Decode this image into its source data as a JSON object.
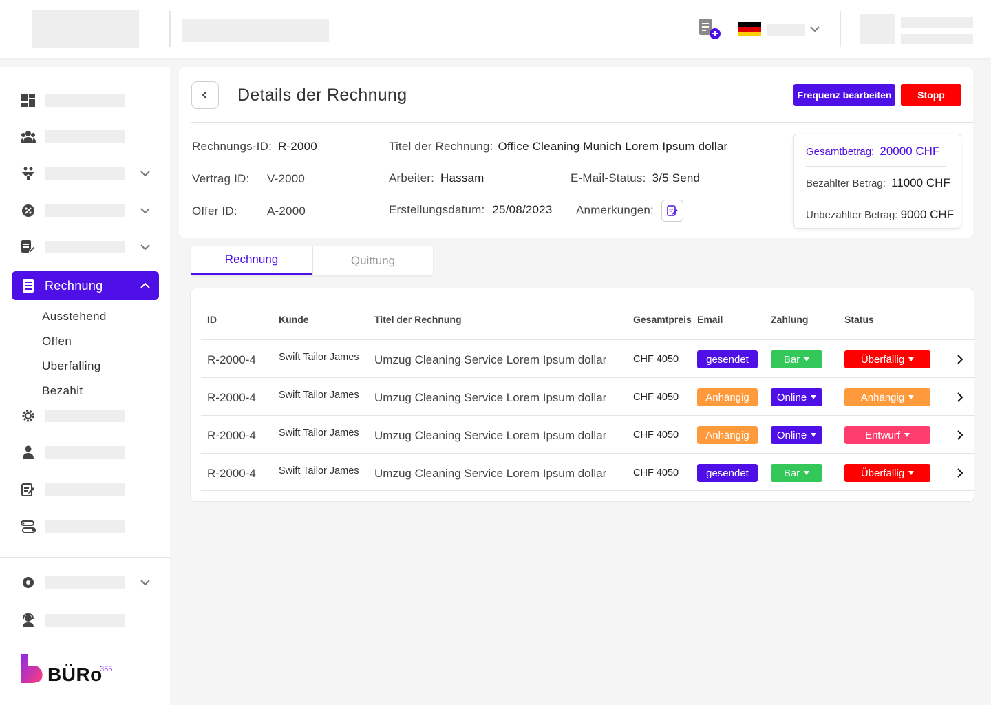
{
  "colors": {
    "primary": "#4f10e8",
    "danger": "#ff0000",
    "orange": "#ff9a3c",
    "green": "#34c759",
    "pink": "#ff3d6e"
  },
  "topbar": {
    "icons": [
      "add-document-icon",
      "german-flag-icon",
      "chevron-down-icon"
    ]
  },
  "sidebar": {
    "icons": [
      "dashboard-icon",
      "users-icon",
      "handshake-icon",
      "badge-icon",
      "edit-document-icon",
      "invoice-icon",
      "settings-gear-icon",
      "person-icon",
      "notes-icon",
      "route-icon",
      "cog-icon",
      "support-icon"
    ],
    "active_label": "Rechnung",
    "sub_items": [
      "Ausstehend",
      "Offen",
      "Uberfalling",
      "Bezahit"
    ],
    "logo_text": "BÜRo",
    "logo_sup": "365"
  },
  "header": {
    "title": "Details der Rechnung",
    "edit_button": "Frequenz bearbeiten",
    "stop_button": "Stopp"
  },
  "details": {
    "invoice_id_label": "Rechnungs-ID:",
    "invoice_id": "R-2000",
    "contract_label": "Vertrag ID:",
    "contract_id": "V-2000",
    "offer_label": "Offer ID:",
    "offer_id": "A-2000",
    "title_label": "Titel der Rechnung:",
    "title_value": "Office Cleaning Munich Lorem Ipsum dollar",
    "worker_label": "Arbeiter:",
    "worker_value": "Hassam",
    "date_label": "Erstellungsdatum:",
    "date_value": "25/08/2023",
    "email_status_label": "E-Mail-Status:",
    "email_status_value": "3/5 Send",
    "notes_label": "Anmerkungen:"
  },
  "totals": {
    "total_label": "Gesamtbetrag:",
    "total_value": "20000 CHF",
    "paid_label": "Bezahlter Betrag:",
    "paid_value": "11000 CHF",
    "unpaid_label": "Unbezahlter Betrag:",
    "unpaid_value": "9000 CHF"
  },
  "tabs": {
    "active": "Rechnung",
    "inactive": "Quittung"
  },
  "table": {
    "headers": [
      "ID",
      "Kunde",
      "Titel der Rechnung",
      "Gesamtpreis",
      "Email",
      "Zahlung",
      "Status"
    ],
    "rows": [
      {
        "id": "R-2000-4",
        "customer": "Swift Tailor James",
        "title": "Umzug Cleaning Service Lorem Ipsum dollar",
        "price": "CHF 4050",
        "email": "gesendet",
        "payment": "Bar",
        "status": "Überfällig"
      },
      {
        "id": "R-2000-4",
        "customer": "Swift Tailor James",
        "title": "Umzug Cleaning Service Lorem Ipsum dollar",
        "price": "CHF 4050",
        "email": "Anhängig",
        "payment": "Online",
        "status": "Anhängig"
      },
      {
        "id": "R-2000-4",
        "customer": "Swift Tailor James",
        "title": "Umzug Cleaning Service Lorem Ipsum dollar",
        "price": "CHF 4050",
        "email": "Anhängig",
        "payment": "Online",
        "status": "Entwurf"
      },
      {
        "id": "R-2000-4",
        "customer": "Swift Tailor James",
        "title": "Umzug Cleaning Service Lorem Ipsum dollar",
        "price": "CHF 4050",
        "email": "gesendet",
        "payment": "Bar",
        "status": "Überfällig"
      }
    ]
  }
}
